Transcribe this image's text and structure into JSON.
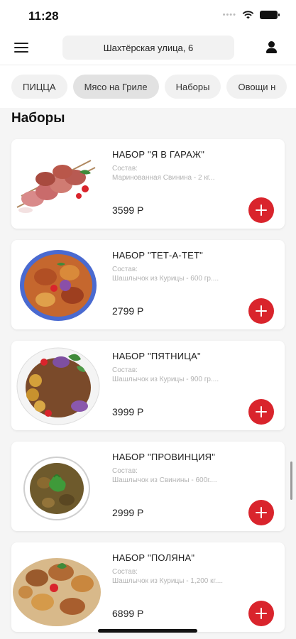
{
  "status_bar": {
    "time": "11:28"
  },
  "header": {
    "menu_icon": "hamburger-icon",
    "address": "Шахтёрская улица, 6",
    "profile_icon": "user-icon"
  },
  "categories": [
    {
      "label": "ПИЦЦА",
      "active": false
    },
    {
      "label": "Мясо на Гриле",
      "active": true
    },
    {
      "label": "Наборы",
      "active": false
    },
    {
      "label": "Овощи н",
      "active": false
    }
  ],
  "section_title": "Наборы",
  "products": [
    {
      "name": "НАБОР \"Я В ГАРАЖ\"",
      "composition_label": "Состав:",
      "composition": "Маринованная Свинина - 2 кг...",
      "price": "3599 Р",
      "image": "skewers-image"
    },
    {
      "name": "НАБОР \"ТЕТ-А-ТЕТ\"",
      "composition_label": "Состав:",
      "composition": "Шашлычок из Курицы - 600 гр....",
      "price": "2799 Р",
      "image": "grill-platter-image"
    },
    {
      "name": "НАБОР \"ПЯТНИЦА\"",
      "composition_label": "Состав:",
      "composition": "Шашлычок из Курицы - 900 гр....",
      "price": "3999 Р",
      "image": "friday-platter-image"
    },
    {
      "name": "НАБОР \"ПРОВИНЦИЯ\"",
      "composition_label": "Состав:",
      "composition": "Шашлычок из Свинины - 600г....",
      "price": "2999 Р",
      "image": "province-platter-image"
    },
    {
      "name": "НАБОР \"ПОЛЯНА\"",
      "composition_label": "Состав:",
      "composition": "Шашлычок из Курицы - 1,200 кг....",
      "price": "6899 Р",
      "image": "polyana-platter-image"
    }
  ],
  "colors": {
    "accent": "#d9242c",
    "background": "#f5f5f5",
    "card": "#ffffff"
  }
}
